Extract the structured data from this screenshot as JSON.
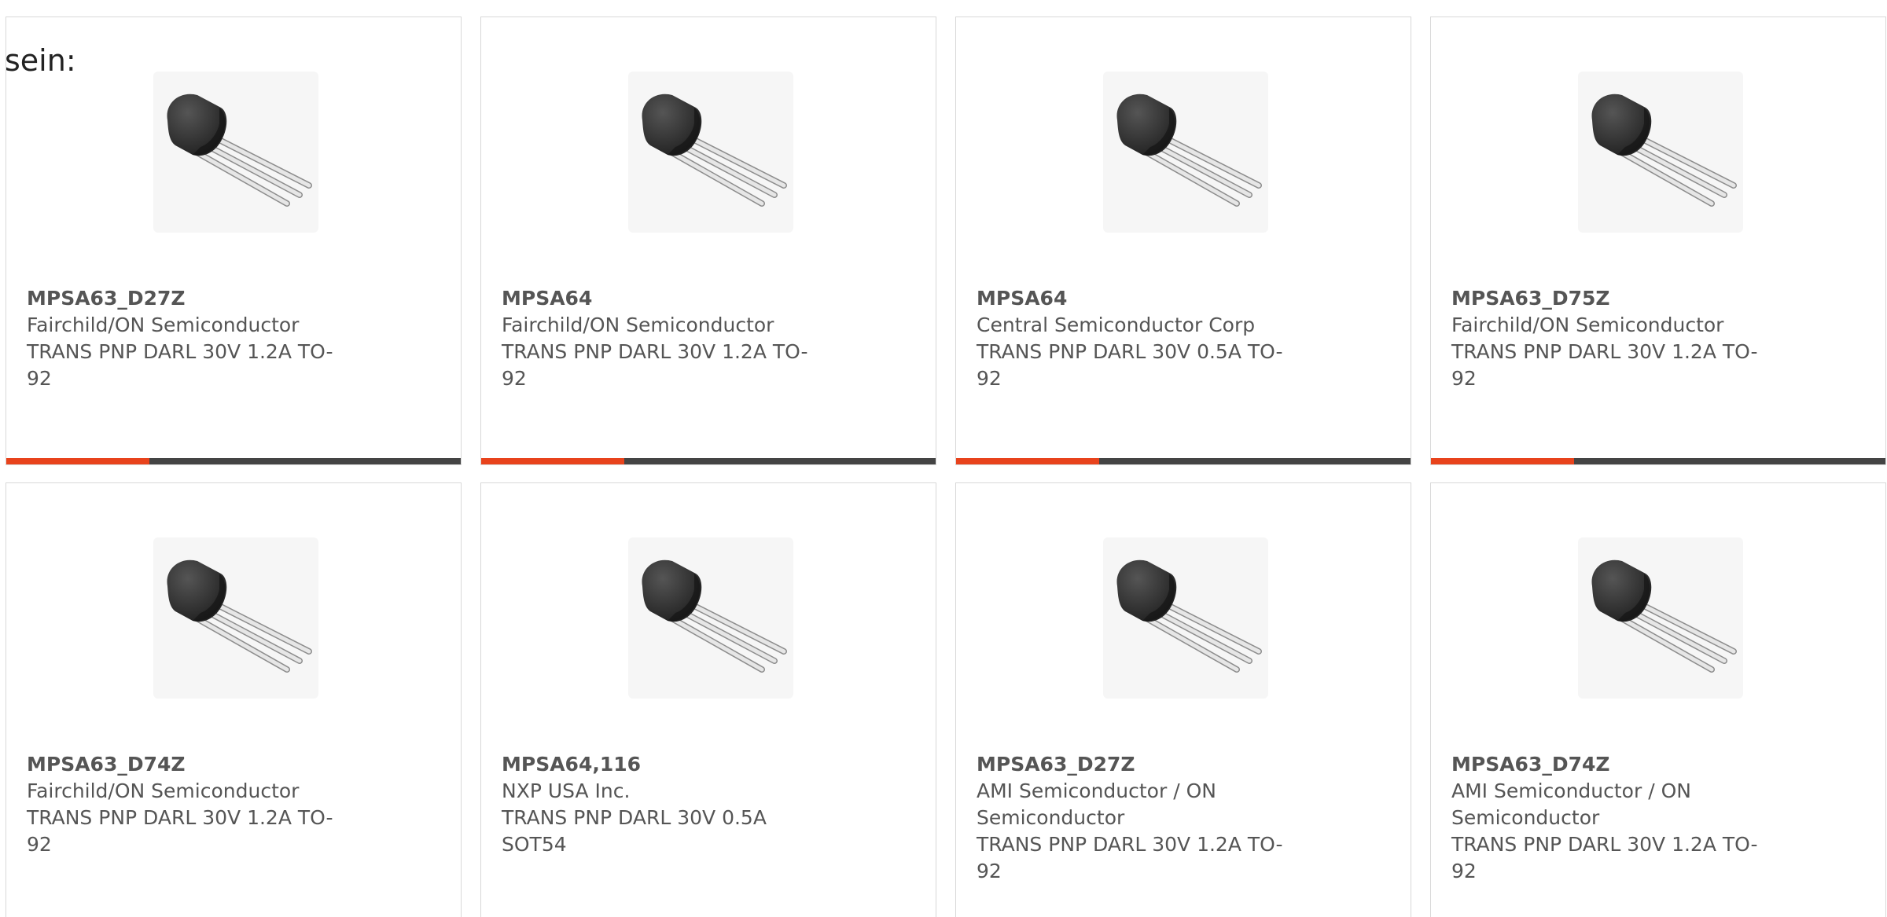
{
  "intro_text": "sein:",
  "colors": {
    "accent": "#e8431c",
    "bar": "#444444",
    "text": "#555555",
    "border": "#d8d8d8"
  },
  "products": [
    {
      "part": "MPSA63_D27Z",
      "manufacturer": "Fairchild/ON Semiconductor",
      "description": "TRANS PNP DARL 30V 1.2A TO-92",
      "image_icon": "to92-transistor-icon"
    },
    {
      "part": "MPSA64",
      "manufacturer": "Fairchild/ON Semiconductor",
      "description": "TRANS PNP DARL 30V 1.2A TO-92",
      "image_icon": "to92-transistor-icon"
    },
    {
      "part": "MPSA64",
      "manufacturer": "Central Semiconductor Corp",
      "description": "TRANS PNP DARL 30V 0.5A TO-92",
      "image_icon": "to92-transistor-icon"
    },
    {
      "part": "MPSA63_D75Z",
      "manufacturer": "Fairchild/ON Semiconductor",
      "description": "TRANS PNP DARL 30V 1.2A TO-92",
      "image_icon": "to92-transistor-icon"
    },
    {
      "part": "MPSA63_D74Z",
      "manufacturer": "Fairchild/ON Semiconductor",
      "description": "TRANS PNP DARL 30V 1.2A TO-92",
      "image_icon": "to92-transistor-icon"
    },
    {
      "part": "MPSA64,116",
      "manufacturer": "NXP USA Inc.",
      "description": "TRANS PNP DARL 30V 0.5A SOT54",
      "image_icon": "to92-transistor-icon"
    },
    {
      "part": "MPSA63_D27Z",
      "manufacturer": "AMI Semiconductor / ON Semiconductor",
      "description": "TRANS PNP DARL 30V 1.2A TO-92",
      "image_icon": "to92-transistor-icon"
    },
    {
      "part": "MPSA63_D74Z",
      "manufacturer": "AMI Semiconductor / ON Semiconductor",
      "description": "TRANS PNP DARL 30V 1.2A TO-92",
      "image_icon": "to92-transistor-icon"
    }
  ]
}
